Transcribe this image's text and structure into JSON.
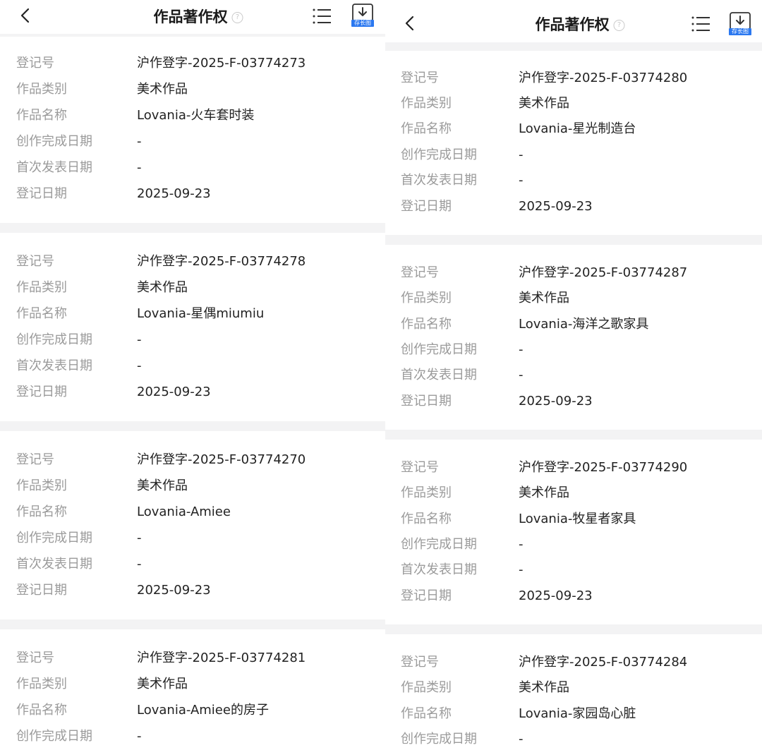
{
  "colors": {
    "accent": "#2b78f0",
    "label": "#9b9b9b",
    "value": "#222222",
    "background": "#f3f3f4"
  },
  "header": {
    "title": "作品著作权",
    "help_icon": "question-circle-icon",
    "menu_icon": "list-menu-icon",
    "save_icon": "download-icon",
    "save_label": "存长图"
  },
  "labels": {
    "reg_no": "登记号",
    "category": "作品类别",
    "name": "作品名称",
    "created": "创作完成日期",
    "published": "首次发表日期",
    "reg_date": "登记日期"
  },
  "left": {
    "records": [
      {
        "reg_no": "沪作登字-2025-F-03774273",
        "category": "美术作品",
        "name": "Lovania-火车套时装",
        "created": "-",
        "published": "-",
        "reg_date": "2025-09-23"
      },
      {
        "reg_no": "沪作登字-2025-F-03774278",
        "category": "美术作品",
        "name": "Lovania-星偶miumiu",
        "created": "-",
        "published": "-",
        "reg_date": "2025-09-23"
      },
      {
        "reg_no": "沪作登字-2025-F-03774270",
        "category": "美术作品",
        "name": "Lovania-Amiee",
        "created": "-",
        "published": "-",
        "reg_date": "2025-09-23"
      },
      {
        "reg_no": "沪作登字-2025-F-03774281",
        "category": "美术作品",
        "name": "Lovania-Amiee的房子",
        "created": "-"
      }
    ]
  },
  "right": {
    "records": [
      {
        "reg_no": "沪作登字-2025-F-03774280",
        "category": "美术作品",
        "name": "Lovania-星光制造台",
        "created": "-",
        "published": "-",
        "reg_date": "2025-09-23"
      },
      {
        "reg_no": "沪作登字-2025-F-03774287",
        "category": "美术作品",
        "name": "Lovania-海洋之歌家具",
        "created": "-",
        "published": "-",
        "reg_date": "2025-09-23"
      },
      {
        "reg_no": "沪作登字-2025-F-03774290",
        "category": "美术作品",
        "name": "Lovania-牧星者家具",
        "created": "-",
        "published": "-",
        "reg_date": "2025-09-23"
      },
      {
        "reg_no": "沪作登字-2025-F-03774284",
        "category": "美术作品",
        "name": "Lovania-家园岛心脏",
        "created": "-"
      }
    ]
  }
}
